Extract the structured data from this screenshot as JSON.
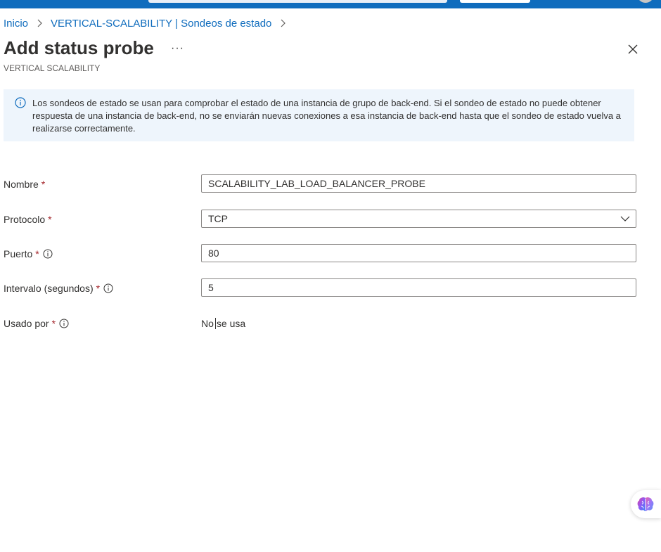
{
  "breadcrumb": {
    "items": [
      "Inicio",
      "VERTICAL-SCALABILITY | Sondeos de estado"
    ]
  },
  "header": {
    "title": "Add status probe",
    "more_label": "···",
    "subtitle": "VERTICAL SCALABILITY"
  },
  "info": {
    "text": "Los sondeos de estado se usan para comprobar el estado de una instancia de grupo de back-end. Si el sondeo de estado no puede obtener respuesta de una instancia de back-end, no se enviarán nuevas conexiones a esa instancia de back-end hasta que el sondeo de estado vuelva a realizarse correctamente."
  },
  "form": {
    "required_mark": "*",
    "name": {
      "label": "Nombre",
      "value": "SCALABILITY_LAB_LOAD_BALANCER_PROBE"
    },
    "protocol": {
      "label": "Protocolo",
      "value": "TCP"
    },
    "port": {
      "label": "Puerto",
      "value": "80"
    },
    "interval": {
      "label": "Intervalo (segundos)",
      "value": "5"
    },
    "used_by": {
      "label": "Usado por",
      "value_before": "No",
      "value_after": "se usa"
    }
  },
  "colors": {
    "accent": "#0f6cbd",
    "required": "#a4262c",
    "info_bg": "#eef5fc"
  },
  "icons": [
    "chevron-right-icon",
    "close-icon",
    "info-icon",
    "chevron-down-icon",
    "brain-icon"
  ]
}
